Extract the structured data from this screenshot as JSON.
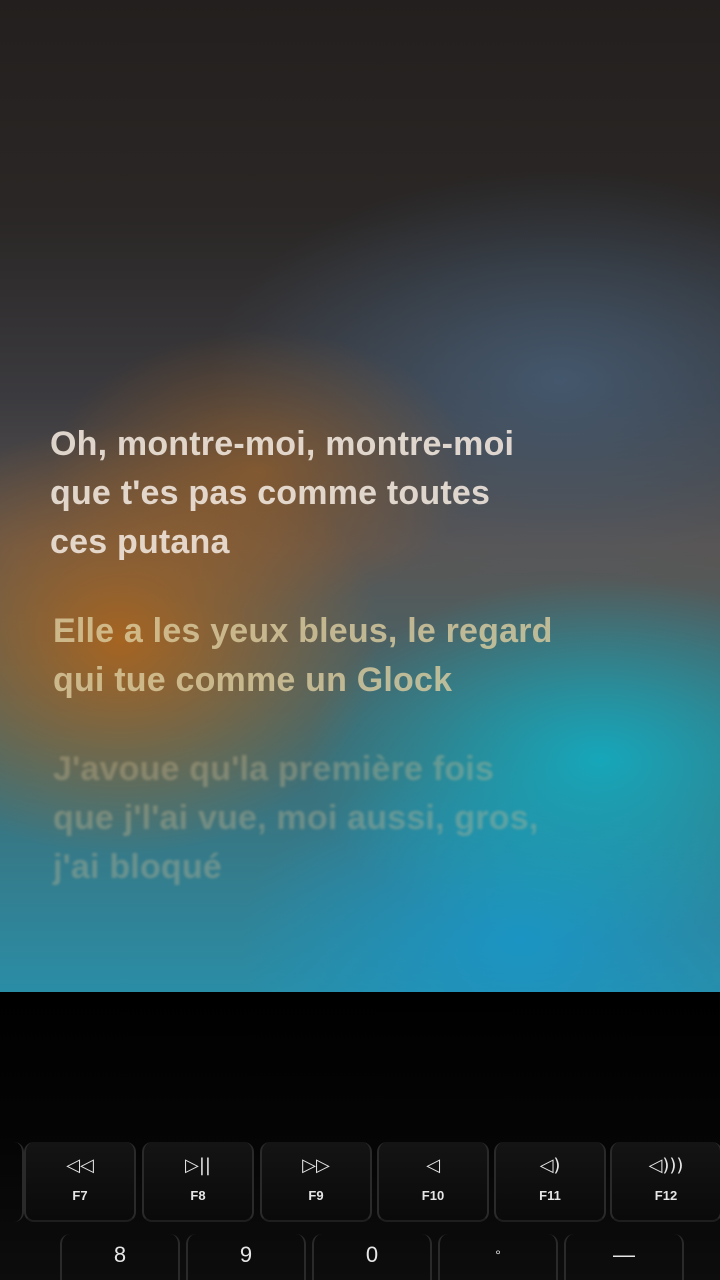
{
  "lyrics": {
    "verse1": [
      "Oh, montre-moi, montre-moi",
      "que t'es pas comme toutes",
      "ces putana"
    ],
    "verse2": [
      "Elle a les yeux bleus, le regard",
      "qui tue comme un Glock"
    ],
    "verse3": [
      "J'avoue qu'la première fois",
      "que j'l'ai vue, moi aussi, gros,",
      "j'ai bloqué"
    ]
  },
  "keyboard": {
    "function_keys": [
      {
        "glyph": "◁◁",
        "icon": "rewind-icon",
        "label": "F7"
      },
      {
        "glyph": "▷||",
        "icon": "play-pause-icon",
        "label": "F8"
      },
      {
        "glyph": "▷▷",
        "icon": "fast-forward-icon",
        "label": "F9"
      },
      {
        "glyph": "◁",
        "icon": "mute-icon",
        "label": "F10"
      },
      {
        "glyph": "◁)",
        "icon": "volume-down-icon",
        "label": "F11"
      },
      {
        "glyph": "◁)))",
        "icon": "volume-up-icon",
        "label": "F12"
      }
    ],
    "number_keys": [
      "8",
      "9",
      "0",
      "°",
      "—"
    ]
  }
}
